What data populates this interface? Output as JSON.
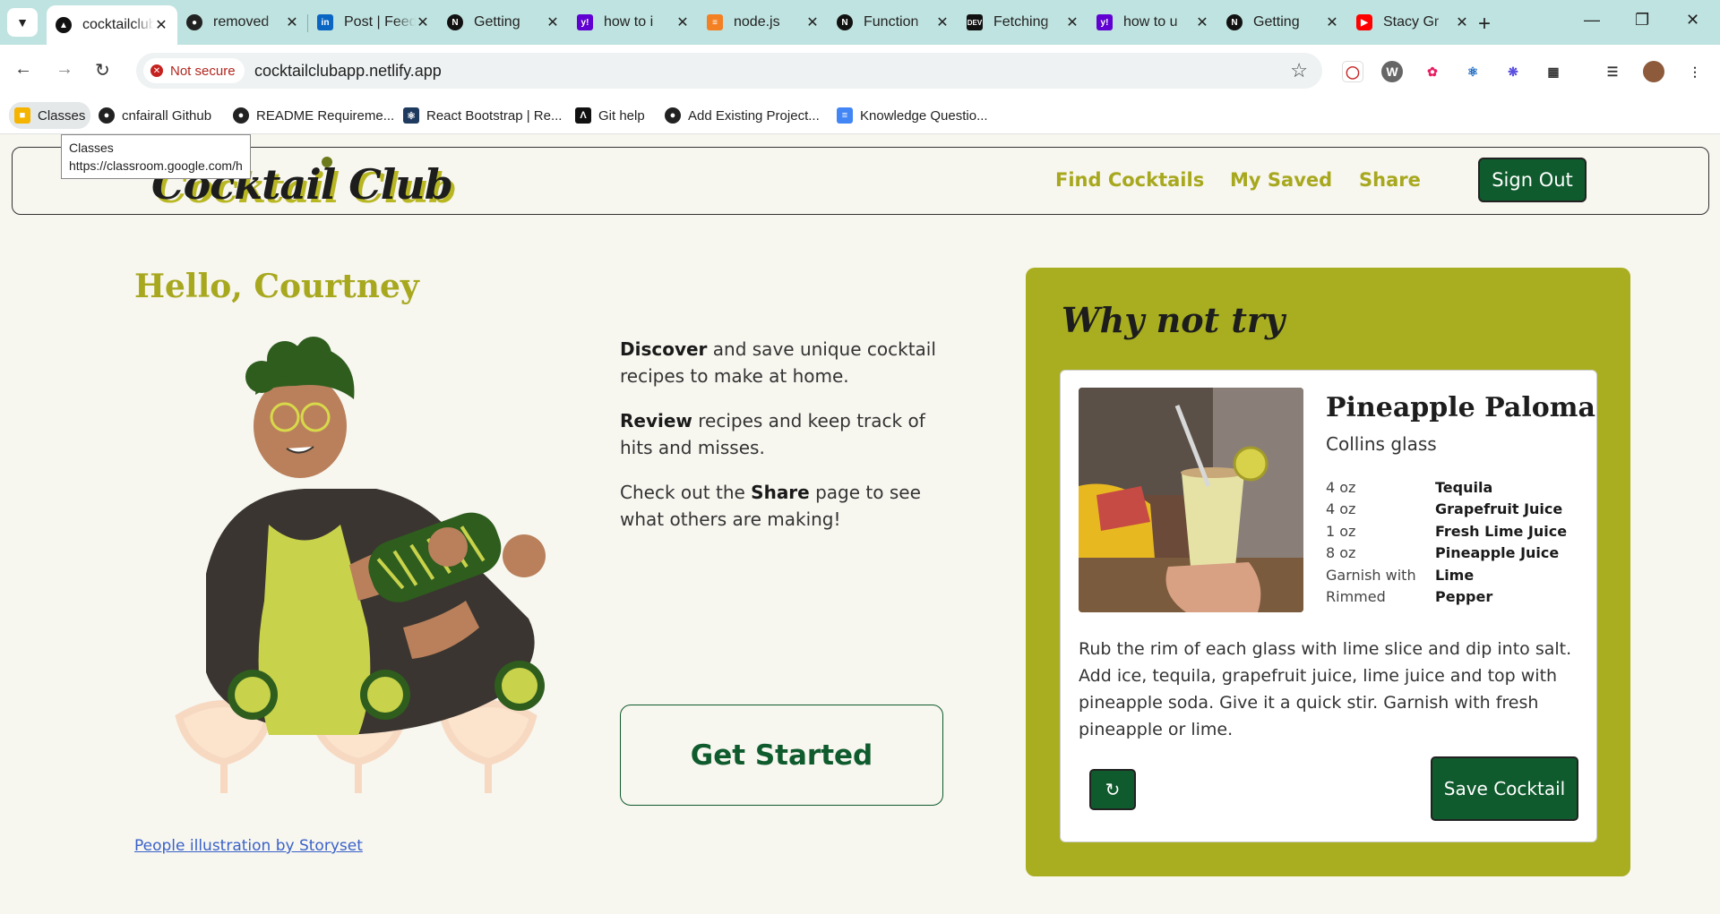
{
  "browser": {
    "tabs": [
      {
        "title": "cocktailclub",
        "icon": "netlify-icon",
        "active": true
      },
      {
        "title": "removed",
        "icon": "github-icon"
      },
      {
        "title": "Post | Feed",
        "icon": "linkedin-icon"
      },
      {
        "title": "Getting",
        "icon": "nextjs-icon"
      },
      {
        "title": "how to i",
        "icon": "yahoo-icon"
      },
      {
        "title": "node.js",
        "icon": "stackoverflow-icon"
      },
      {
        "title": "Function",
        "icon": "nextjs-icon"
      },
      {
        "title": "Fetching",
        "icon": "dev-icon"
      },
      {
        "title": "how to u",
        "icon": "yahoo-icon"
      },
      {
        "title": "Getting",
        "icon": "nextjs-icon"
      },
      {
        "title": "Stacy Gr",
        "icon": "youtube-icon"
      }
    ],
    "security_label": "Not secure",
    "url": "cocktailclubapp.netlify.app",
    "bookmarks": [
      {
        "label": "Classes",
        "icon": "google-classroom-icon"
      },
      {
        "label": "cnfairall Github",
        "icon": "github-icon"
      },
      {
        "label": "README Requireme...",
        "icon": "github-icon"
      },
      {
        "label": "React Bootstrap | Re...",
        "icon": "react-bootstrap-icon"
      },
      {
        "label": "Git help",
        "icon": "git-icon"
      },
      {
        "label": "Add Existing Project...",
        "icon": "github-icon"
      },
      {
        "label": "Knowledge Questio...",
        "icon": "google-docs-icon"
      }
    ],
    "tooltip": {
      "line1": "Classes",
      "line2": "https://classroom.google.com/h"
    }
  },
  "site": {
    "logo": "Cocktail Club",
    "nav": [
      {
        "label": "Find Cocktails"
      },
      {
        "label": "My Saved"
      },
      {
        "label": "Share"
      }
    ],
    "sign_out": "Sign Out",
    "greeting": "Hello, Courtney",
    "intro": [
      {
        "bold": "Discover",
        "text": " and save unique cocktail recipes to make at home."
      },
      {
        "bold": "Review",
        "text": " recipes and keep track of hits and misses."
      },
      {
        "pre": "Check out the ",
        "bold": "Share",
        "text": " page to see what others are making!"
      }
    ],
    "get_started": "Get Started",
    "credit": "People illustration by Storyset",
    "suggestion": {
      "heading": "Why not try",
      "name": "Pineapple Paloma",
      "glass": "Collins glass",
      "ingredients": [
        {
          "measure": "4 oz",
          "name": "Tequila"
        },
        {
          "measure": "4 oz",
          "name": "Grapefruit Juice"
        },
        {
          "measure": "1 oz",
          "name": "Fresh Lime Juice"
        },
        {
          "measure": "8 oz",
          "name": "Pineapple Juice"
        },
        {
          "measure": "Garnish with",
          "name": "Lime"
        },
        {
          "measure": "Rimmed",
          "name": "Pepper"
        }
      ],
      "instructions": "Rub the rim of each glass with lime slice and dip into salt. Add ice, tequila, grapefruit juice, lime juice and top with pineapple soda. Give it a quick stir. Garnish with fresh pineapple or lime.",
      "save_label": "Save Cocktail"
    }
  },
  "colors": {
    "accent_olive": "#a8ae1f",
    "brand_green": "#0f5b2d",
    "page_bg": "#f7f6ef"
  }
}
